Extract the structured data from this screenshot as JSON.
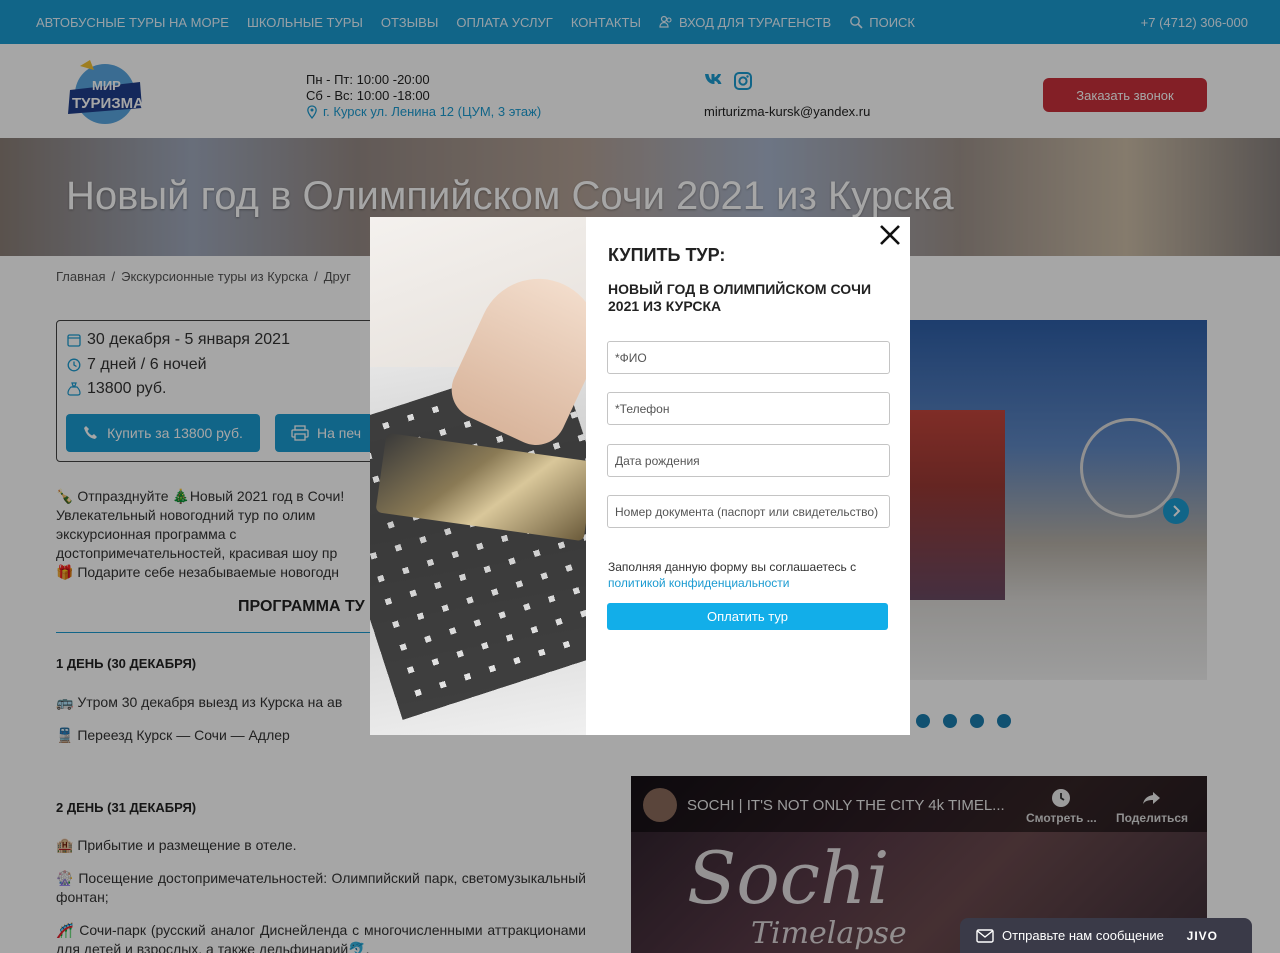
{
  "topnav": {
    "items": [
      "Автобусные туры на море",
      "Школьные туры",
      "Отзывы",
      "Оплата услуг",
      "Контакты"
    ],
    "agent_login": "Вход для турагенств",
    "search": "Поиск",
    "phone": "+7 (4712) 306-000"
  },
  "header": {
    "logo_text": [
      "МИР",
      "ТУРИЗМА"
    ],
    "hours_weekday": "Пн - Пт: 10:00 -20:00",
    "hours_weekend": "Сб - Вс: 10:00 -18:00",
    "address": "г. Курск ул. Ленина 12 (ЦУМ, 3 этаж)",
    "email": "mirturizma-kursk@yandex.ru",
    "call_button": "Заказать звонок"
  },
  "hero": {
    "title": "Новый год в Олимпийском Сочи 2021 из Курска"
  },
  "breadcrumb": {
    "home": "Главная",
    "section": "Экскурсионные туры из Курска",
    "sub": "Друг"
  },
  "tour": {
    "dates": "30 декабря - 5 января 2021",
    "duration": "7 дней / 6 ночей",
    "price": "13800 руб.",
    "buy_button": "Купить за 13800 руб.",
    "print_button": "На печ"
  },
  "description": {
    "line1": "🍾 Отпразднуйте 🎄Новый 2021 год в Сочи!",
    "line2": "Увлекательный новогодний тур по олим",
    "line3": "экскурсионная программа с",
    "line4": "достопримечательностей, красивая шоу пр",
    "line5": "🎁 Подарите себе незабываемые новогодн"
  },
  "program": {
    "title": "ПРОГРАММА ТУ",
    "day1_title": "1 ДЕНЬ (30 ДЕКАБРЯ)",
    "day1_text1": "🚌 Утром 30 декабря выезд из Курска на ав",
    "day1_text2": "🚆 Переезд Курск — Сочи — Адлер",
    "day2_title": "2 ДЕНЬ (31 ДЕКАБРЯ)",
    "day2_text1": "🏨 Прибытие и размещение в отеле.",
    "day2_text2": "🎡 Посещение достопримечательностей: Олимпийский парк, светомузыкальный фонтан;",
    "day2_text3": "🎢 Сочи-парк (русский аналог Диснейленда с многочисленными аттракционами для детей и взрослых, а также дельфинарий🐬,"
  },
  "video": {
    "title": "SOCHI | IT'S NOT ONLY THE CITY 4k TIMEL...",
    "watch_later": "Смотреть ...",
    "share": "Поделиться",
    "overlay_big": "Sochi",
    "overlay_small": "Timelapse"
  },
  "modal": {
    "title": "КУПИТЬ ТУР:",
    "subtitle": "Новый год в Олимпийском Сочи 2021 из Курска",
    "fields": {
      "name": "*ФИО",
      "phone": "*Телефон",
      "birth": "Дата рождения",
      "doc": "Номер документа (паспорт или свидетельство)"
    },
    "agree_text": "Заполняя данную форму вы соглашаетесь с",
    "agree_link": "политикой конфиденциальности",
    "pay_button": "Оплатить тур"
  },
  "chat": {
    "label": "Отправьте нам сообщение",
    "brand": "JIVO"
  },
  "colors": {
    "accent": "#1b9bd1",
    "call_button": "#c9313b",
    "pay_button": "#12aee9"
  }
}
